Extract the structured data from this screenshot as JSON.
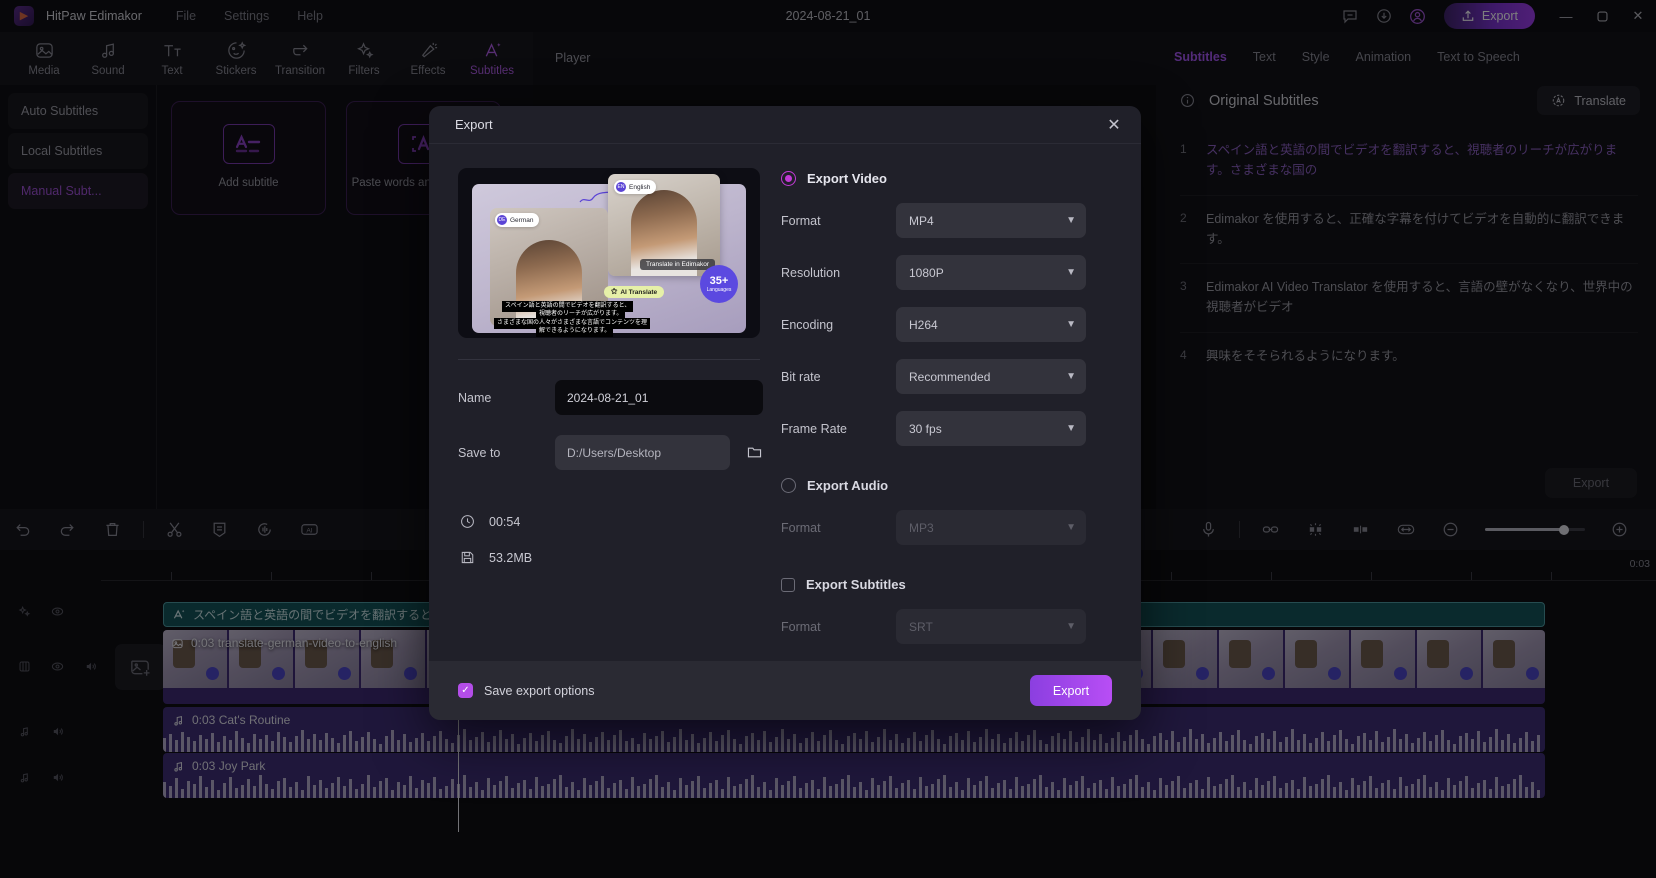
{
  "titlebar": {
    "app_name": "HitPaw Edimakor",
    "menu": [
      "File",
      "Settings",
      "Help"
    ],
    "document_title": "2024-08-21_01",
    "export_label": "Export",
    "icons": [
      "feedback-icon",
      "download-icon",
      "account-icon"
    ],
    "window_controls": [
      "minimize",
      "maximize",
      "close"
    ]
  },
  "toolbar": {
    "items": [
      {
        "label": "Media",
        "icon": "media-icon"
      },
      {
        "label": "Sound",
        "icon": "sound-icon"
      },
      {
        "label": "Text",
        "icon": "text-icon"
      },
      {
        "label": "Stickers",
        "icon": "stickers-icon"
      },
      {
        "label": "Transition",
        "icon": "transition-icon"
      },
      {
        "label": "Filters",
        "icon": "filters-icon"
      },
      {
        "label": "Effects",
        "icon": "effects-icon"
      },
      {
        "label": "Subtitles",
        "icon": "subtitles-icon"
      }
    ],
    "active": "Subtitles"
  },
  "left_panel": {
    "modes": [
      "Auto Subtitles",
      "Local Subtitles",
      "Manual Subt..."
    ],
    "active_mode": "Manual Subt...",
    "cards": [
      {
        "label": "Add subtitle",
        "icon": "add-subtitle-icon"
      },
      {
        "label": "Paste words and\nto subtitles",
        "icon": "paste-words-icon"
      }
    ]
  },
  "player": {
    "tab_label": "Player"
  },
  "right_panel": {
    "tabs": [
      "Subtitles",
      "Text",
      "Style",
      "Animation",
      "Text to Speech"
    ],
    "active_tab": "Subtitles",
    "section_title": "Original Subtitles",
    "translate_label": "Translate",
    "export_label": "Export",
    "subtitles": [
      {
        "num": "1",
        "text": "スペイン語と英語の間でビデオを翻訳すると、視聴者のリーチが広がります。さまざまな国の",
        "selected": true
      },
      {
        "num": "2",
        "text": "Edimakor を使用すると、正確な字幕を付けてビデオを自動的に翻訳できます。",
        "selected": false
      },
      {
        "num": "3",
        "text": "Edimakor AI Video Translator を使用すると、言語の壁がなくなり、世界中の視聴者がビデオ",
        "selected": false
      },
      {
        "num": "4",
        "text": "興味をそそられるようになります。",
        "selected": false
      }
    ]
  },
  "timeline_toolbar": {
    "left_icons": [
      "undo-icon",
      "redo-icon",
      "delete-icon",
      "split-icon",
      "caption-icon",
      "speed-icon",
      "ai-icon"
    ],
    "right_icons": [
      "microphone-icon",
      "link-icon",
      "marker-icon",
      "keyframe-icon",
      "fit-icon",
      "zoom-out-icon",
      "zoom-in-icon"
    ],
    "zoom_value": "79"
  },
  "timeline": {
    "ruler_end_label": "0:03",
    "tracks": [
      {
        "type": "subtitle",
        "label": "スペイン語と英語の間でビデオを翻訳すると、",
        "icon": "text-clip-icon"
      },
      {
        "type": "video",
        "label": "0:03 translate-german-video-to-english",
        "icon": "video-clip-icon"
      },
      {
        "type": "audio",
        "label": "0:03 Cat's Routine",
        "icon": "music-note-icon"
      },
      {
        "type": "audio",
        "label": "0:03 Joy Park",
        "icon": "music-note-icon"
      }
    ],
    "track_header_icons": [
      [
        "effects-track-icon",
        "eye-icon"
      ],
      [
        "save-track-icon",
        "eye-icon",
        "volume-icon"
      ],
      [
        "music-track-icon",
        "volume-icon"
      ],
      [
        "music-track-icon",
        "volume-icon"
      ]
    ],
    "add_media_icon": "add-media-icon"
  },
  "dialog": {
    "title": "Export",
    "close_icon": "close-icon",
    "preview": {
      "chip_left": "German",
      "chip_left_code": "DE",
      "chip_right": "English",
      "chip_right_code": "EN",
      "tag": "Translate in Edimakor",
      "ai_label": "AI Translate",
      "badge_main": "35+",
      "badge_sub": "Languages",
      "subtitle_line1": "スペイン語と英語の間でビデオを翻訳すると、",
      "subtitle_line2": "視聴者のリーチが広がります。",
      "subtitle_line3": "さまざまな国の人々がさまざまな言語でコンテンツを理",
      "subtitle_line4": "解できるようになります。"
    },
    "name_label": "Name",
    "name_value": "2024-08-21_01",
    "saveto_label": "Save to",
    "saveto_value": "D:/Users/Desktop",
    "folder_icon": "folder-icon",
    "duration_icon": "clock-icon",
    "duration_value": "00:54",
    "size_icon": "disk-icon",
    "size_value": "53.2MB",
    "export_video": {
      "title": "Export Video",
      "selected": true,
      "fields": [
        {
          "label": "Format",
          "value": "MP4"
        },
        {
          "label": "Resolution",
          "value": "1080P"
        },
        {
          "label": "Encoding",
          "value": "H264"
        },
        {
          "label": "Bit rate",
          "value": "Recommended"
        },
        {
          "label": "Frame Rate",
          "value": "30  fps"
        }
      ]
    },
    "export_audio": {
      "title": "Export Audio",
      "selected": false,
      "fields": [
        {
          "label": "Format",
          "value": "MP3"
        }
      ]
    },
    "export_subtitles": {
      "title": "Export Subtitles",
      "selected": false,
      "fields": [
        {
          "label": "Format",
          "value": "SRT"
        }
      ]
    },
    "footer": {
      "save_options_label": "Save export options",
      "save_options_checked": true,
      "export_label": "Export"
    }
  },
  "colors": {
    "accent": "#b34de8",
    "accent_purple": "#a855f7",
    "subtitle_track": "#0f5257",
    "video_track": "#3b2772"
  }
}
